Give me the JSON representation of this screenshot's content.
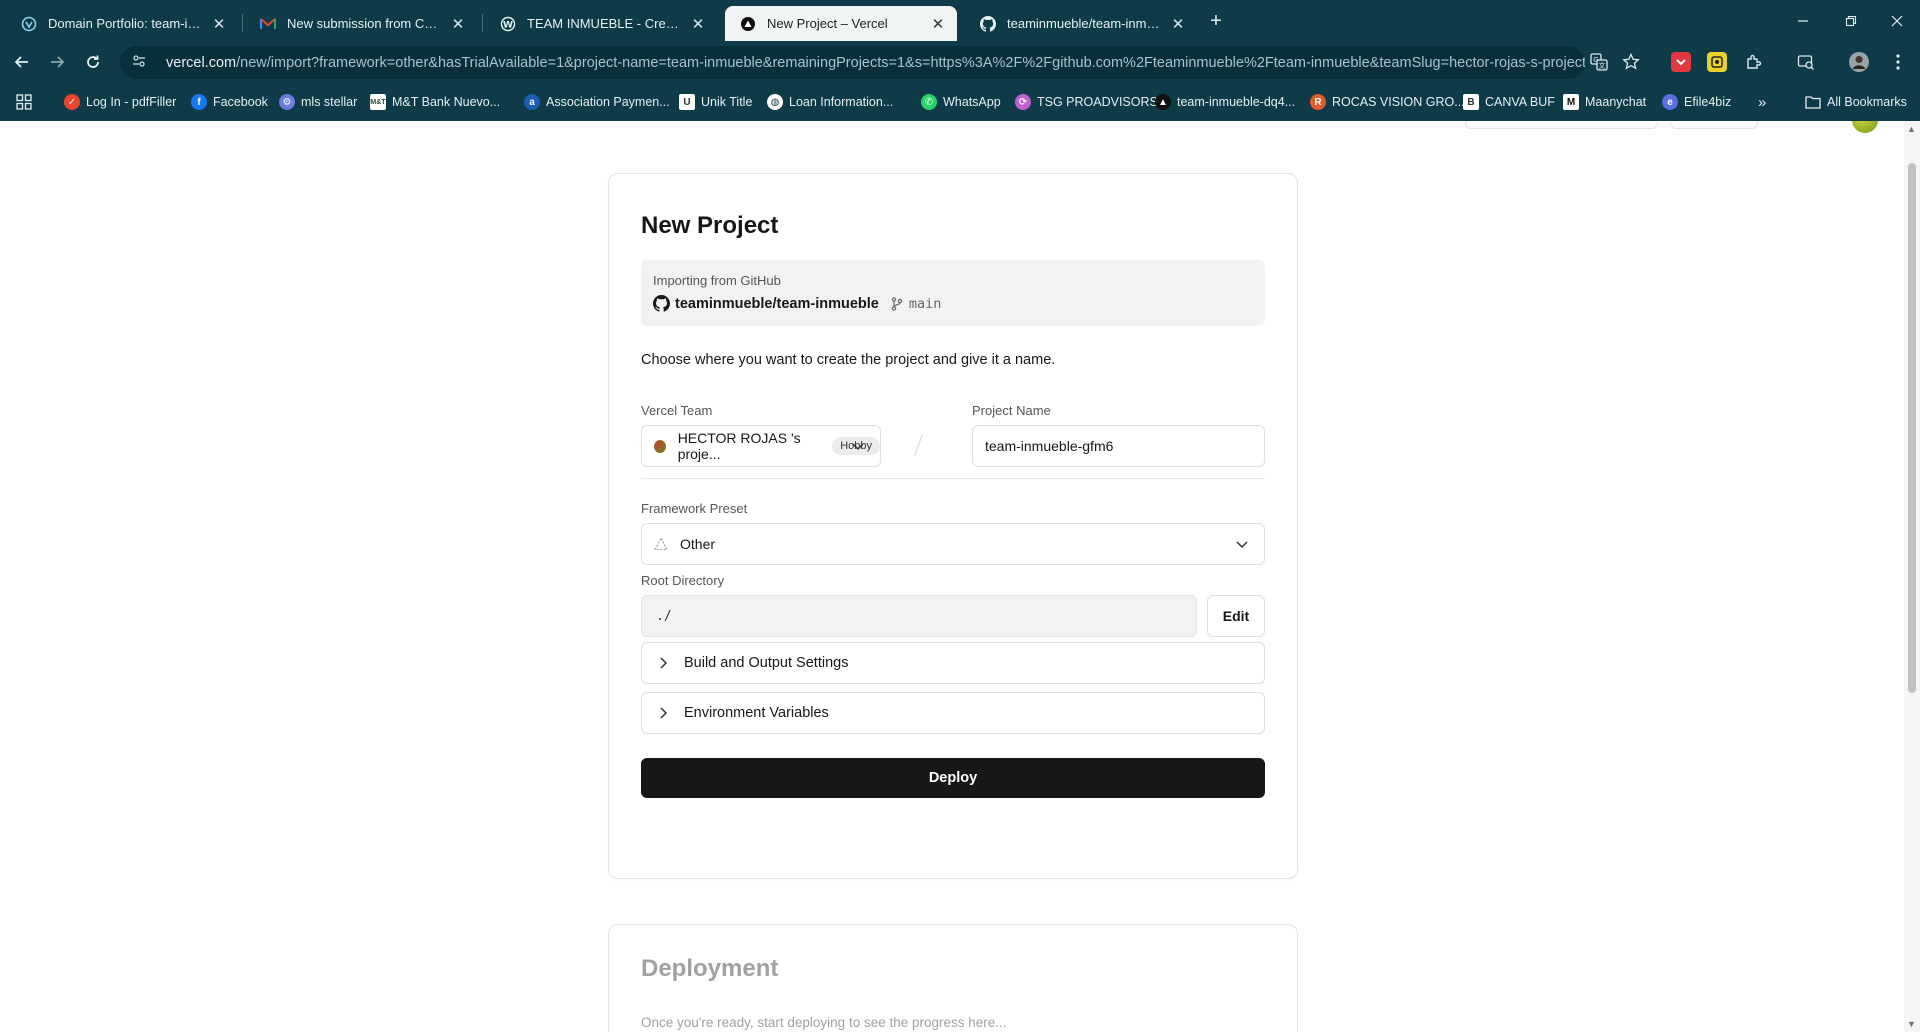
{
  "browser": {
    "tabs": [
      {
        "title": "Domain Portfolio: team-inmueble",
        "icon": "vercel-icon"
      },
      {
        "title": "New submission from Contacto",
        "icon": "gmail-icon"
      },
      {
        "title": "TEAM INMUEBLE - Crear página",
        "icon": "wordpress-icon"
      },
      {
        "title": "New Project – Vercel",
        "icon": "vercel-triangle-icon",
        "active": true
      },
      {
        "title": "teaminmueble/team-inmueble",
        "icon": "github-icon"
      }
    ],
    "url_host": "vercel.com",
    "url_rest": "/new/import?framework=other&hasTrialAvailable=1&project-name=team-inmueble&remainingProjects=1&s=https%3A%2F%2Fgithub.com%2Fteaminmueble%2Fteam-inmueble&teamSlug=hector-rojas-s-projects&t...",
    "bookmarks": [
      {
        "label": "Log In - pdfFiller",
        "color": "#e8452c"
      },
      {
        "label": "Facebook",
        "color": "#1877f2"
      },
      {
        "label": "mls stellar",
        "color": "#6c7ae0"
      },
      {
        "label": "M&T Bank Nuevo...",
        "color": "#ffffff"
      },
      {
        "label": "Association Paymen...",
        "color": "#1a5fb4"
      },
      {
        "label": "Unik Title",
        "color": "#ffffff"
      },
      {
        "label": "Loan Information...",
        "color": "#ffffff"
      },
      {
        "label": "WhatsApp",
        "color": "#25d366"
      },
      {
        "label": "TSG PROADVISORS",
        "color": "#c060d0"
      },
      {
        "label": "team-inmueble-dq4...",
        "color": "#ffffff"
      },
      {
        "label": "ROCAS VISION GRO...",
        "color": "#e35a2b"
      },
      {
        "label": "CANVA BUF",
        "color": "#ffffff"
      },
      {
        "label": "Maanychat",
        "color": "#ffffff"
      },
      {
        "label": "Efile4biz",
        "color": "#5a6ee0"
      }
    ],
    "all_bookmarks": "All Bookmarks",
    "more_bookmarks": "»"
  },
  "page": {
    "title": "New Project",
    "import_label": "Importing from GitHub",
    "repo": "teaminmueble/team-inmueble",
    "branch": "main",
    "choose_text": "Choose where you want to create the project and give it a name.",
    "team_label": "Vercel Team",
    "team_value": "HECTOR ROJAS 's proje...",
    "team_badge": "Hobby",
    "project_name_label": "Project Name",
    "project_name_value": "team-inmueble-gfm6",
    "framework_label": "Framework Preset",
    "framework_value": "Other",
    "root_label": "Root Directory",
    "root_value": "./",
    "edit_label": "Edit",
    "build_settings": "Build and Output Settings",
    "env_vars": "Environment Variables",
    "deploy_label": "Deploy",
    "deployment_title": "Deployment",
    "deployment_sub": "Once you're ready, start deploying to see the progress here..."
  },
  "colors": {
    "chrome": "#0e3b47",
    "deploy_button": "#171717",
    "accent_dot": "#6a8a1f"
  }
}
